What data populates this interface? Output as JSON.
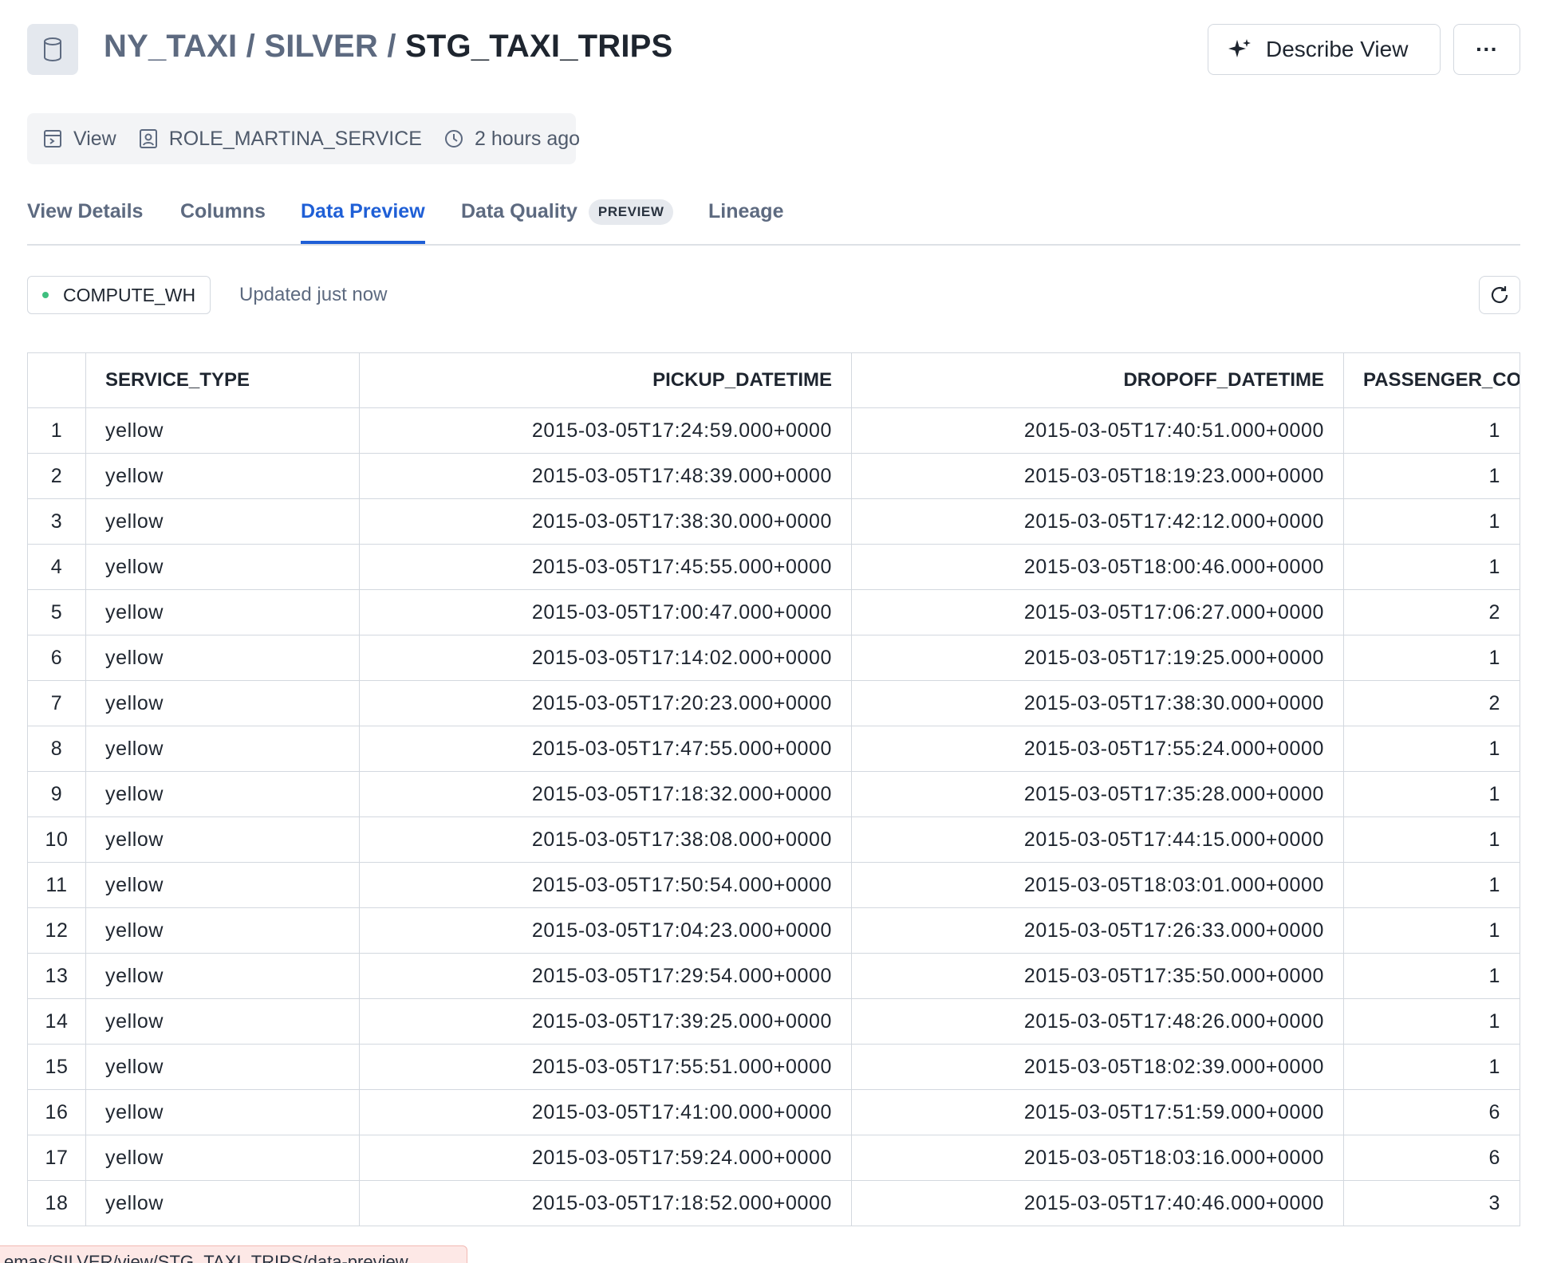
{
  "header": {
    "database": "NY_TAXI",
    "schema": "SILVER",
    "object": "STG_TAXI_TRIPS",
    "separator": " / ",
    "describe_label": "Describe View",
    "more_label": "···"
  },
  "meta": {
    "type": "View",
    "owner": "ROLE_MARTINA_SERVICE",
    "modified": "2 hours ago"
  },
  "tabs": [
    {
      "label": "View Details"
    },
    {
      "label": "Columns"
    },
    {
      "label": "Data Preview",
      "active": true
    },
    {
      "label": "Data Quality",
      "badge": "PREVIEW"
    },
    {
      "label": "Lineage"
    }
  ],
  "toolbar": {
    "warehouse": "COMPUTE_WH",
    "updated": "Updated just now"
  },
  "table": {
    "columns": [
      "",
      "SERVICE_TYPE",
      "PICKUP_DATETIME",
      "DROPOFF_DATETIME",
      "PASSENGER_COUNT"
    ],
    "rows": [
      [
        "1",
        "yellow",
        "2015-03-05T17:24:59.000+0000",
        "2015-03-05T17:40:51.000+0000",
        "1"
      ],
      [
        "2",
        "yellow",
        "2015-03-05T17:48:39.000+0000",
        "2015-03-05T18:19:23.000+0000",
        "1"
      ],
      [
        "3",
        "yellow",
        "2015-03-05T17:38:30.000+0000",
        "2015-03-05T17:42:12.000+0000",
        "1"
      ],
      [
        "4",
        "yellow",
        "2015-03-05T17:45:55.000+0000",
        "2015-03-05T18:00:46.000+0000",
        "1"
      ],
      [
        "5",
        "yellow",
        "2015-03-05T17:00:47.000+0000",
        "2015-03-05T17:06:27.000+0000",
        "2"
      ],
      [
        "6",
        "yellow",
        "2015-03-05T17:14:02.000+0000",
        "2015-03-05T17:19:25.000+0000",
        "1"
      ],
      [
        "7",
        "yellow",
        "2015-03-05T17:20:23.000+0000",
        "2015-03-05T17:38:30.000+0000",
        "2"
      ],
      [
        "8",
        "yellow",
        "2015-03-05T17:47:55.000+0000",
        "2015-03-05T17:55:24.000+0000",
        "1"
      ],
      [
        "9",
        "yellow",
        "2015-03-05T17:18:32.000+0000",
        "2015-03-05T17:35:28.000+0000",
        "1"
      ],
      [
        "10",
        "yellow",
        "2015-03-05T17:38:08.000+0000",
        "2015-03-05T17:44:15.000+0000",
        "1"
      ],
      [
        "11",
        "yellow",
        "2015-03-05T17:50:54.000+0000",
        "2015-03-05T18:03:01.000+0000",
        "1"
      ],
      [
        "12",
        "yellow",
        "2015-03-05T17:04:23.000+0000",
        "2015-03-05T17:26:33.000+0000",
        "1"
      ],
      [
        "13",
        "yellow",
        "2015-03-05T17:29:54.000+0000",
        "2015-03-05T17:35:50.000+0000",
        "1"
      ],
      [
        "14",
        "yellow",
        "2015-03-05T17:39:25.000+0000",
        "2015-03-05T17:48:26.000+0000",
        "1"
      ],
      [
        "15",
        "yellow",
        "2015-03-05T17:55:51.000+0000",
        "2015-03-05T18:02:39.000+0000",
        "1"
      ],
      [
        "16",
        "yellow",
        "2015-03-05T17:41:00.000+0000",
        "2015-03-05T17:51:59.000+0000",
        "6"
      ],
      [
        "17",
        "yellow",
        "2015-03-05T17:59:24.000+0000",
        "2015-03-05T18:03:16.000+0000",
        "6"
      ],
      [
        "18",
        "yellow",
        "2015-03-05T17:18:52.000+0000",
        "2015-03-05T17:40:46.000+0000",
        "3"
      ]
    ]
  },
  "status_link": "emas/SILVER/view/STG_TAXI_TRIPS/data-preview",
  "colors": {
    "accent": "#1f5fd6",
    "warehouse_dot": "#3fbf7f",
    "muted_text": "#5d6a80"
  },
  "icons": {
    "object": "database-icon",
    "describe": "sparkle-icon",
    "more": "more-horizontal-icon",
    "type": "view-icon",
    "owner": "user-badge-icon",
    "modified": "clock-icon",
    "refresh": "refresh-icon"
  }
}
